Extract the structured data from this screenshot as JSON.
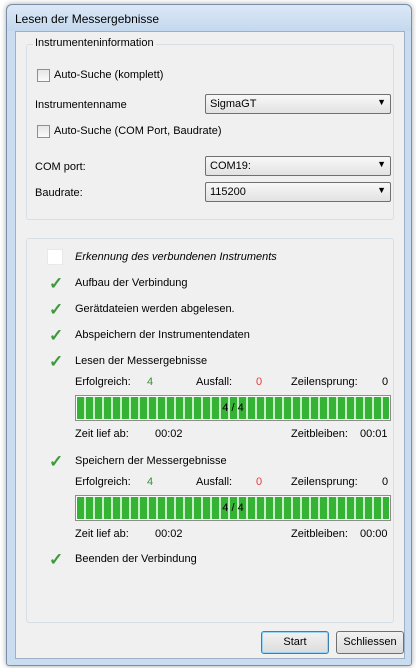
{
  "window": {
    "title": "Lesen der Messergebnisse"
  },
  "instrument_info": {
    "legend": "Instrumenteninformation",
    "auto_search_full": "Auto-Suche (komplett)",
    "instrument_name_label": "Instrumentenname",
    "instrument_name_value": "SigmaGT",
    "auto_search_com": "Auto-Suche (COM Port, Baudrate)",
    "com_port_label": "COM port:",
    "com_port_value": "COM19:",
    "baudrate_label": "Baudrate:",
    "baudrate_value": "115200"
  },
  "steps": {
    "detect": "Erkennung des verbundenen Instruments",
    "connect": "Aufbau der Verbindung",
    "read_device_files": "Gerätdateien werden abgelesen.",
    "save_instrument_data": "Abspeichern der Instrumentendaten",
    "read_results": "Lesen der Messergebnisse",
    "save_results": "Speichern der Messergebnisse",
    "finish": "Beenden der Verbindung"
  },
  "read_block": {
    "success_label": "Erfolgreich:",
    "success_value": "4",
    "fail_label": "Ausfall:",
    "fail_value": "0",
    "skip_label": "Zeilensprung:",
    "skip_value": "0",
    "progress_text": "4 / 4",
    "progress_fraction": 1.0,
    "elapsed_label": "Zeit lief ab:",
    "elapsed_value": "00:02",
    "remaining_label": "Zeitbleiben:",
    "remaining_value": "00:01"
  },
  "save_block": {
    "success_label": "Erfolgreich:",
    "success_value": "4",
    "fail_label": "Ausfall:",
    "fail_value": "0",
    "skip_label": "Zeilensprung:",
    "skip_value": "0",
    "progress_text": "4 / 4",
    "progress_fraction": 1.0,
    "elapsed_label": "Zeit lief ab:",
    "elapsed_value": "00:02",
    "remaining_label": "Zeitbleiben:",
    "remaining_value": "00:00"
  },
  "buttons": {
    "start": "Start",
    "close": "Schliessen"
  },
  "colors": {
    "success": "#3a8f3a",
    "failure": "#e03c3c",
    "progress": "#34b334",
    "check": "#3d9a3d"
  }
}
